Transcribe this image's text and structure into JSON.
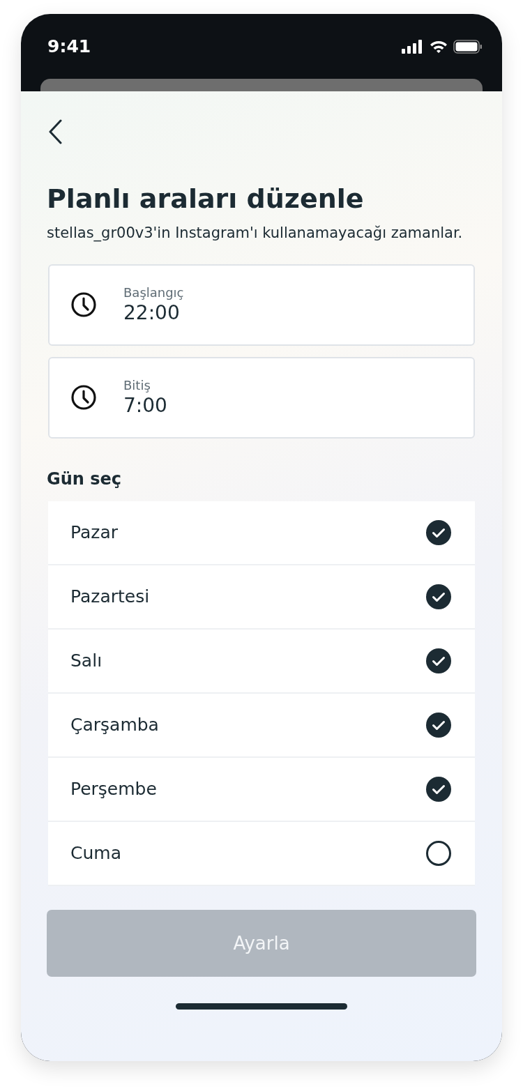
{
  "status_bar": {
    "time": "9:41"
  },
  "title": "Planlı araları düzenle",
  "subtitle": "stellas_gr00v3'in Instagram'ı kullanamayacağı zamanlar.",
  "times": [
    {
      "label": "Başlangıç",
      "value": "22:00"
    },
    {
      "label": "Bitiş",
      "value": "7:00"
    }
  ],
  "days_heading": "Gün seç",
  "days": [
    {
      "label": "Pazar",
      "checked": true
    },
    {
      "label": "Pazartesi",
      "checked": true
    },
    {
      "label": "Salı",
      "checked": true
    },
    {
      "label": "Çarşamba",
      "checked": true
    },
    {
      "label": "Perşembe",
      "checked": true
    },
    {
      "label": "Cuma",
      "checked": false
    }
  ],
  "button": {
    "label": "Ayarla",
    "disabled": true
  }
}
